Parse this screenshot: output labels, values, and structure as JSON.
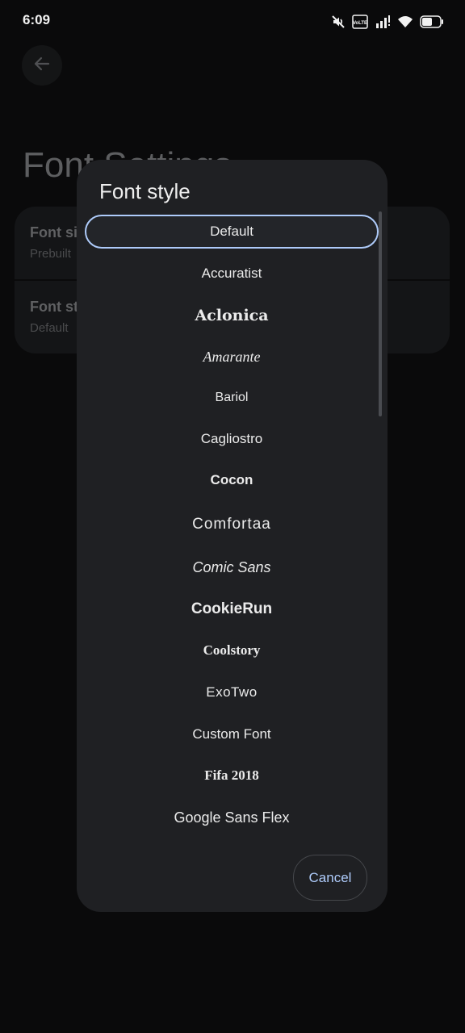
{
  "status_bar": {
    "time": "6:09",
    "icons": [
      "mute-icon",
      "volte-icon",
      "signal-icon",
      "wifi-icon",
      "battery-icon"
    ],
    "volte_text": "VoLTE"
  },
  "background_page": {
    "back_icon": "arrow-left-icon",
    "title": "Font Settings",
    "rows": [
      {
        "title": "Font size",
        "subtitle": "Prebuilt"
      },
      {
        "title": "Font style",
        "subtitle": "Default"
      }
    ]
  },
  "dialog": {
    "title": "Font style",
    "selected_index": 0,
    "accent_color": "#aecbfa",
    "items": [
      "Default",
      "Accuratist",
      "Aclonica",
      "Amarante",
      "Bariol",
      "Cagliostro",
      "Cocon",
      "Comfortaa",
      "Comic Sans",
      "CookieRun",
      "Coolstory",
      "ExoTwo",
      "Custom Font",
      "Fifa 2018",
      "Google Sans Flex"
    ],
    "cancel_label": "Cancel"
  }
}
